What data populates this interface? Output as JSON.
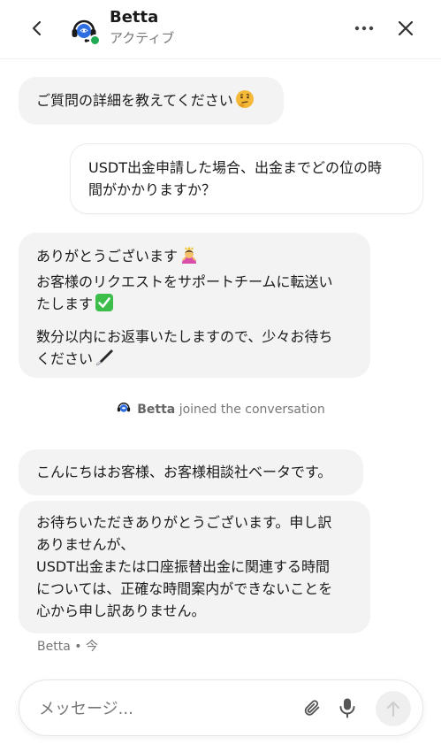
{
  "header": {
    "agent_name": "Betta",
    "status": "アクティブ"
  },
  "messages": [
    {
      "from": "bot",
      "lines": [
        "ご質問の詳細を教えてください"
      ],
      "emoji": "thinking-face"
    },
    {
      "from": "user",
      "lines": [
        "USDT出金申請した場合、出金までどの位の時",
        "間がかかりますか？"
      ]
    },
    {
      "from": "bot",
      "lines": [
        "ありがとうございます",
        "お客様のリクエストをサポートチームに転送い",
        "たします",
        "数分以内にお返事いたしますので、少々お待ち",
        "ください"
      ]
    },
    {
      "from": "bot",
      "lines": [
        "こんにちはお客様、お客様相談社ベータです。"
      ]
    },
    {
      "from": "bot",
      "lines": [
        "お待ちいただきありがとうございます。申し訳",
        "ありませんが、",
        "USDT出金または口座振替出金に関連する時間",
        "については、正確な時間案内ができないことを",
        "心から申し訳ありません。"
      ]
    }
  ],
  "join_notice": {
    "name": "Betta",
    "text": "joined the conversation"
  },
  "meta": {
    "sender": "Betta",
    "separator": "•",
    "time": "今"
  },
  "composer": {
    "placeholder": "メッセージ..."
  },
  "colors": {
    "bot_bubble": "#f3f3f3",
    "status_green": "#1faa54",
    "avatar_blue": "#2f6ee0"
  }
}
